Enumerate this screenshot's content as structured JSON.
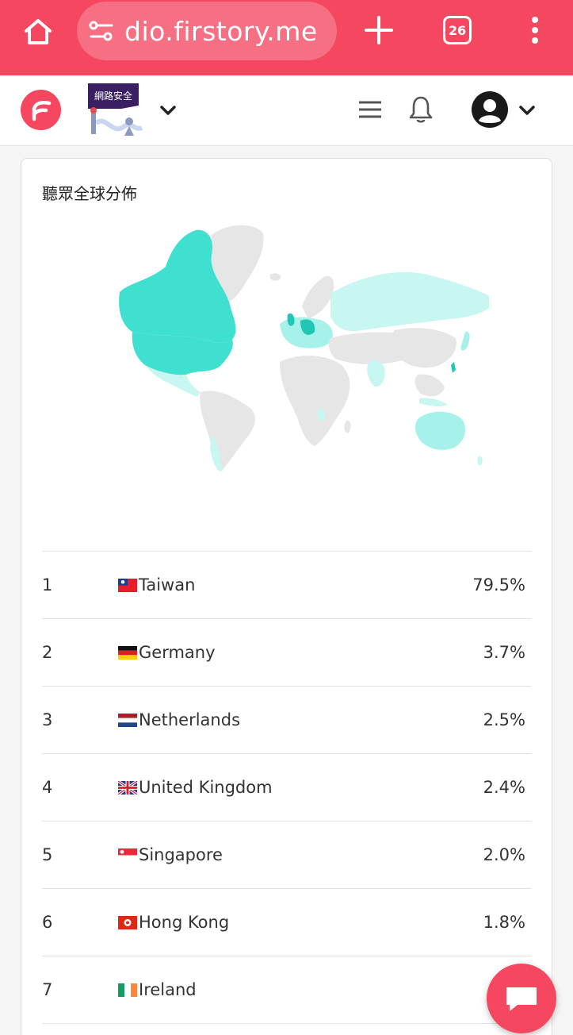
{
  "browser": {
    "url_text": "dio.firstory.me",
    "tab_count": "26",
    "home_icon": "home-icon",
    "site_settings_icon": "tune-icon",
    "new_tab_icon": "plus-icon",
    "menu_icon": "more-vert-icon",
    "theme_color": "#f5475f"
  },
  "header": {
    "logo_icon": "firstory-logo-icon",
    "podcast_cover_label": "網路安全",
    "icons": [
      "chevron-down-icon",
      "hamburger-icon",
      "bell-icon",
      "account-circle-icon"
    ]
  },
  "card": {
    "title": "聽眾全球分佈",
    "map_colors": {
      "high": "#40e0d0",
      "medium": "#a6f2ea",
      "low": "#c8f7f2",
      "none": "#e6e6e6",
      "highlight": "#1fc7b4"
    }
  },
  "ranking": [
    {
      "rank": "1",
      "flag": "tw",
      "country": "Taiwan",
      "percent": "79.5%"
    },
    {
      "rank": "2",
      "flag": "de",
      "country": "Germany",
      "percent": "3.7%"
    },
    {
      "rank": "3",
      "flag": "nl",
      "country": "Netherlands",
      "percent": "2.5%"
    },
    {
      "rank": "4",
      "flag": "gb",
      "country": "United Kingdom",
      "percent": "2.4%"
    },
    {
      "rank": "5",
      "flag": "sg",
      "country": "Singapore",
      "percent": "2.0%"
    },
    {
      "rank": "6",
      "flag": "hk",
      "country": "Hong Kong",
      "percent": "1.8%"
    },
    {
      "rank": "7",
      "flag": "ie",
      "country": "Ireland",
      "percent": ""
    }
  ],
  "chat": {
    "icon": "chat-bubble-icon"
  }
}
